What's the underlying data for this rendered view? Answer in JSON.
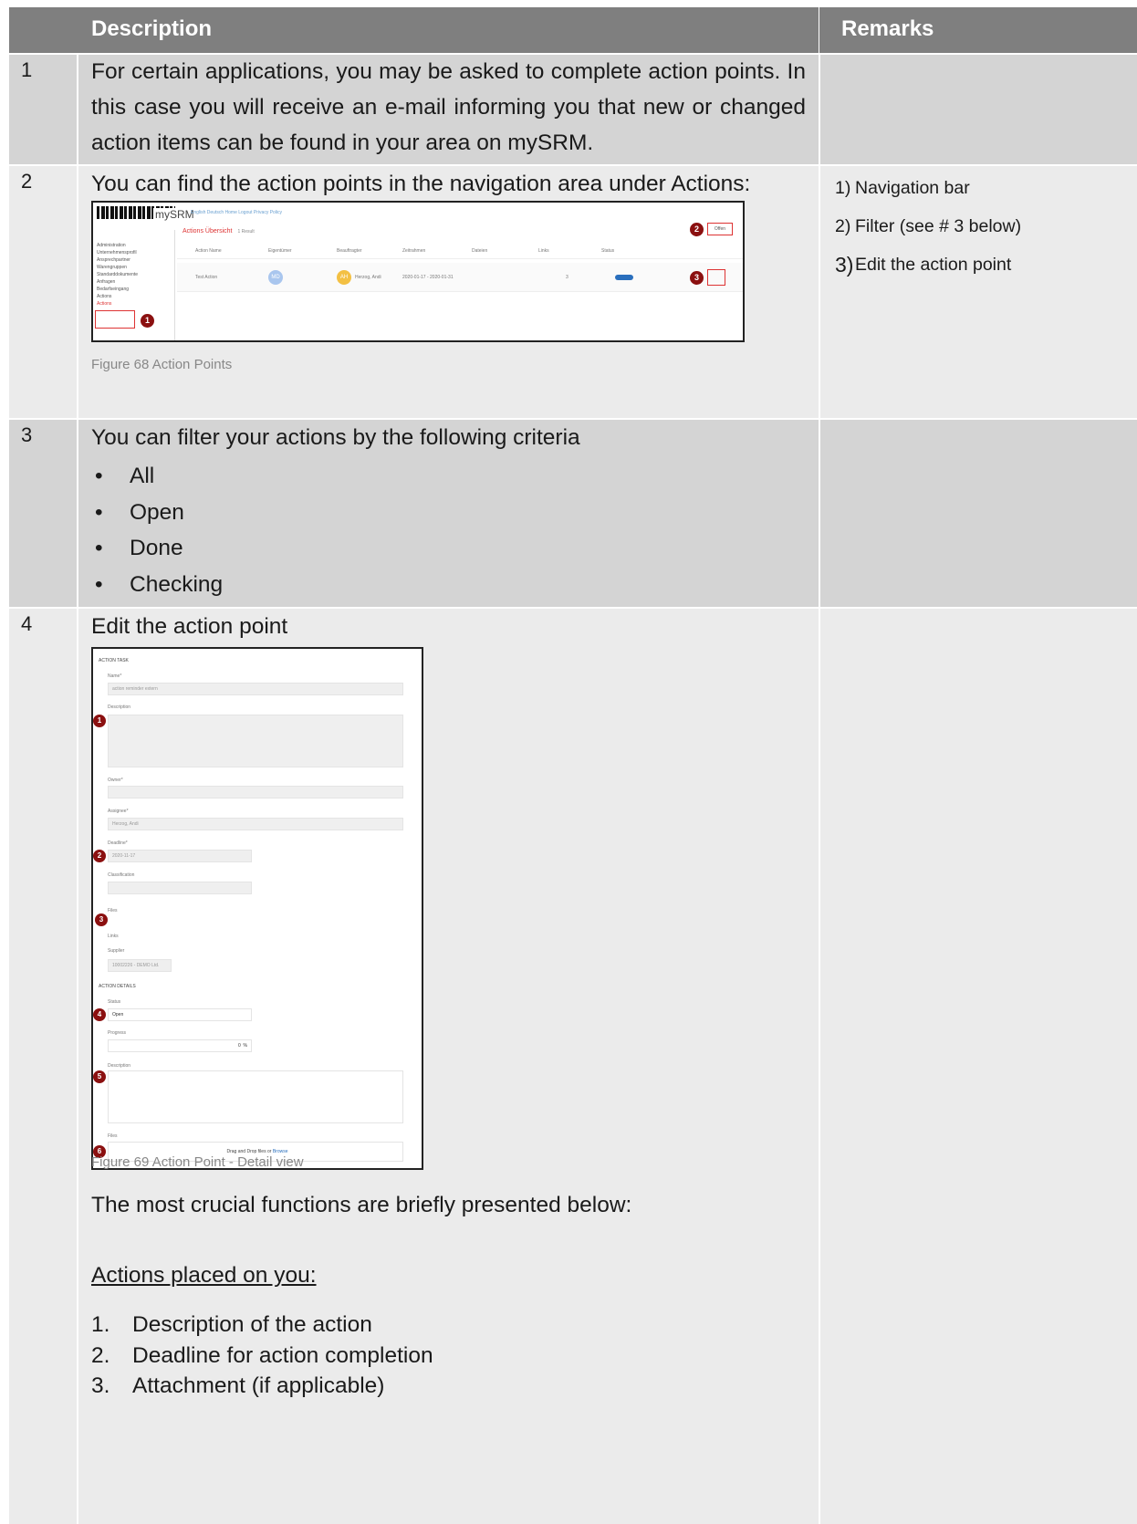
{
  "header": {
    "col_description": "Description",
    "col_remarks": "Remarks"
  },
  "rows": [
    {
      "num": "1",
      "text": "For certain applications, you may be asked to complete action points. In this case you will receive an e-mail informing you that new or changed action items can be found in your area on mySRM."
    },
    {
      "num": "2",
      "text": "You can find the action points in the navigation area under Actions:",
      "caption": "Figure 68 Action Points",
      "remarks": [
        {
          "n": "1)",
          "text": "Navigation bar"
        },
        {
          "n": "2)",
          "text": "Filter (see # 3 below)"
        },
        {
          "n": "3)",
          "text": "Edit the action point"
        }
      ]
    },
    {
      "num": "3",
      "text": "You can filter your actions by the following criteria",
      "bullets": [
        "All",
        "Open",
        "Done",
        "Checking"
      ]
    },
    {
      "num": "4",
      "text": "Edit the action point",
      "caption": "Figure 69 Action Point - Detail view",
      "intro": "The most crucial functions are briefly presented below:",
      "subheading": "Actions placed on you:",
      "items": [
        {
          "n": "1.",
          "text": "Description of the action"
        },
        {
          "n": "2.",
          "text": "Deadline for action completion"
        },
        {
          "n": "3.",
          "text": "Attachment (if applicable)"
        }
      ]
    }
  ],
  "screenshot1": {
    "brand": "mySRM",
    "top_links": "English  Deutsch    Home  Logout  Privacy Policy",
    "title": "Actions Übersicht",
    "result": "1 Result",
    "filter": "Offen",
    "sidebar": [
      "Administration",
      "Unternehmensprofil",
      "Ansprechpartner",
      "Warengruppen",
      "Standarddokumente",
      "Anfragen",
      "Bedarfseingang",
      "Actions",
      "Actions"
    ],
    "columns": [
      "Action Name",
      "Eigentümer",
      "Beauftragter",
      "Zeitrahmen",
      "Dateien",
      "Links",
      "Status"
    ],
    "row": {
      "name": "Test Action",
      "owner_initials": "MD",
      "assignee_initials": "AH",
      "assignee": "Herzog, Andi",
      "timeframe": "2020-01-17 - 2020-01-31",
      "links": "3",
      "status": "OFFEN"
    },
    "markers": [
      "1",
      "2",
      "3"
    ]
  },
  "screenshot2": {
    "section_task": "ACTION TASK",
    "name_label": "Name*",
    "name_value": "action reminder extern",
    "description_label": "Description",
    "owner_label": "Owner*",
    "assignee_label": "Assignee*",
    "assignee_value": "Herzog, Andi",
    "deadline_label": "Deadline*",
    "deadline_value": "2020-11-17",
    "classification_label": "Classification",
    "files_label": "Files",
    "links_label": "Links",
    "supplier_label": "Supplier",
    "supplier_value": "10002226 - DEMO Ltd.",
    "section_details": "ACTION DETAILS",
    "status_label": "Status",
    "status_value": "Open",
    "progress_label": "Progress",
    "progress_value": "0",
    "progress_unit": "%",
    "description2_label": "Description",
    "files2_label": "Files",
    "drop_text": "Drag and Drop files or",
    "browse_text": "Browse",
    "markers": [
      "1",
      "2",
      "3",
      "4",
      "5",
      "6"
    ]
  }
}
